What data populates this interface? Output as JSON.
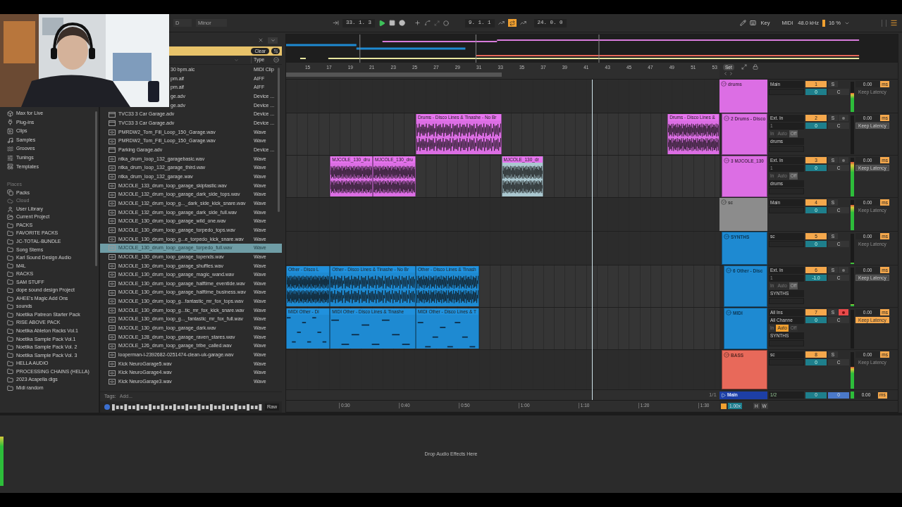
{
  "top_bar": {
    "key_root": "D",
    "scale": "Minor",
    "position": "33. 1. 3",
    "playing": true,
    "loop_start": "9. 1. 1",
    "loop_on": true,
    "loop_length": "24. 0. 0",
    "key_label": "Key",
    "midi_label": "MIDI",
    "sample_rate": "48.0 kHz",
    "cpu": "16 %"
  },
  "browser": {
    "categories": [
      {
        "label": "Max for Live",
        "kind": "max"
      },
      {
        "label": "Plug-ins",
        "kind": "plugins"
      },
      {
        "label": "Clips",
        "kind": "clips"
      },
      {
        "label": "Samples",
        "kind": "samples"
      },
      {
        "label": "Grooves",
        "kind": "grooves"
      },
      {
        "label": "Tunings",
        "kind": "tunings"
      },
      {
        "label": "Templates",
        "kind": "templates"
      }
    ],
    "places_heading": "Places",
    "places": [
      {
        "label": "Packs",
        "kind": "packs",
        "disabled": false
      },
      {
        "label": "Cloud",
        "kind": "cloud",
        "disabled": true
      },
      {
        "label": "User Library",
        "kind": "user",
        "disabled": false
      },
      {
        "label": "Current Project",
        "kind": "project",
        "disabled": false
      },
      {
        "label": "PACKS",
        "kind": "folder",
        "disabled": false
      },
      {
        "label": "FAVORITE PACKS",
        "kind": "folder",
        "disabled": false
      },
      {
        "label": "JC-TOTAL-BUNDLE",
        "kind": "folder",
        "disabled": false
      },
      {
        "label": "Song Stems",
        "kind": "folder",
        "disabled": false
      },
      {
        "label": "Karl Sound Design Audio",
        "kind": "folder",
        "disabled": false
      },
      {
        "label": "M4L",
        "kind": "folder",
        "disabled": false
      },
      {
        "label": "RACKS",
        "kind": "folder",
        "disabled": false
      },
      {
        "label": "SAM STUFF",
        "kind": "folder",
        "disabled": false
      },
      {
        "label": "dope sound design Project",
        "kind": "folder",
        "disabled": false
      },
      {
        "label": "AHEE's Magic Add Ons",
        "kind": "folder",
        "disabled": false
      },
      {
        "label": "sounds",
        "kind": "folder",
        "disabled": false
      },
      {
        "label": "Noetika Patreon Starter Pack",
        "kind": "folder",
        "disabled": false
      },
      {
        "label": "RISE ABOVE PACK",
        "kind": "folder",
        "disabled": false
      },
      {
        "label": "Noetika Ableton Racks Vol.1",
        "kind": "folder",
        "disabled": false
      },
      {
        "label": "Noetika Sample Pack Vol.1",
        "kind": "folder",
        "disabled": false
      },
      {
        "label": "Noetika Sample Pack Vol. 2",
        "kind": "folder",
        "disabled": false
      },
      {
        "label": "Noetika Sample Pack Vol. 3",
        "kind": "folder",
        "disabled": false
      },
      {
        "label": "HELLA AUDIO",
        "kind": "folder",
        "disabled": false
      },
      {
        "label": "PROCESSING CHAINS (HELLA)",
        "kind": "folder",
        "disabled": false
      },
      {
        "label": "2023 Acapella digs",
        "kind": "folder",
        "disabled": false
      },
      {
        "label": "Midi random",
        "kind": "folder",
        "disabled": false
      }
    ],
    "clear_label": "Clear",
    "type_heading": "Type",
    "files": [
      {
        "name": "30 bpm.alc",
        "type": "MIDI Clip",
        "kind": "cut",
        "selected": false
      },
      {
        "name": "pm.aif",
        "type": "AIFF",
        "kind": "cut",
        "selected": false
      },
      {
        "name": "pm.aif",
        "type": "AIFF",
        "kind": "cut",
        "selected": false
      },
      {
        "name": "ge.adv",
        "type": "Device ...",
        "kind": "cut",
        "selected": false
      },
      {
        "name": "ge.adv",
        "type": "Device ...",
        "kind": "cut",
        "selected": false
      },
      {
        "name": "TVC33 3 Car Garage.adv",
        "type": "Device ...",
        "kind": "preset",
        "selected": false
      },
      {
        "name": "TVC33 3 Car Garage.adv",
        "type": "Device ...",
        "kind": "preset",
        "selected": false
      },
      {
        "name": "PMRDW2_Tom_Fill_Loop_150_Garage.wav",
        "type": "Wave",
        "kind": "audio",
        "selected": false
      },
      {
        "name": "PMRDW2_Tom_Fill_Loop_150_Garage.wav",
        "type": "Wave",
        "kind": "audio",
        "selected": false
      },
      {
        "name": "Parking Garage.adv",
        "type": "Device ...",
        "kind": "preset",
        "selected": false
      },
      {
        "name": "ntka_drum_loop_132_garagebasic.wav",
        "type": "Wave",
        "kind": "audio",
        "selected": false
      },
      {
        "name": "ntka_drum_loop_132_garage_third.wav",
        "type": "Wave",
        "kind": "audio",
        "selected": false
      },
      {
        "name": "ntka_drum_loop_132_garage.wav",
        "type": "Wave",
        "kind": "audio",
        "selected": false
      },
      {
        "name": "MJCOLE_133_drum_loop_garage_skiptastic.wav",
        "type": "Wave",
        "kind": "audio",
        "selected": false
      },
      {
        "name": "MJCOLE_132_drum_loop_garage_dark_side_tops.wav",
        "type": "Wave",
        "kind": "audio",
        "selected": false
      },
      {
        "name": "MJCOLE_132_drum_loop_g..._dark_side_kick_snare.wav",
        "type": "Wave",
        "kind": "audio",
        "selected": false
      },
      {
        "name": "MJCOLE_132_drum_loop_garage_dark_side_full.wav",
        "type": "Wave",
        "kind": "audio",
        "selected": false
      },
      {
        "name": "MJCOLE_130_drum_loop_garage_wild_one.wav",
        "type": "Wave",
        "kind": "audio",
        "selected": false
      },
      {
        "name": "MJCOLE_130_drum_loop_garage_torpedo_tops.wav",
        "type": "Wave",
        "kind": "audio",
        "selected": false
      },
      {
        "name": "MJCOLE_130_drum_loop_g...e_torpedo_kick_snare.wav",
        "type": "Wave",
        "kind": "audio",
        "selected": false
      },
      {
        "name": "MJCOLE_130_drum_loop_garage_torpedo_full.wav",
        "type": "Wave",
        "kind": "audio",
        "selected": true
      },
      {
        "name": "MJCOLE_130_drum_loop_garage_topends.wav",
        "type": "Wave",
        "kind": "audio",
        "selected": false
      },
      {
        "name": "MJCOLE_130_drum_loop_garage_shuffles.wav",
        "type": "Wave",
        "kind": "audio",
        "selected": false
      },
      {
        "name": "MJCOLE_130_drum_loop_garage_magic_wand.wav",
        "type": "Wave",
        "kind": "audio",
        "selected": false
      },
      {
        "name": "MJCOLE_130_drum_loop_garage_halftime_eventide.wav",
        "type": "Wave",
        "kind": "audio",
        "selected": false
      },
      {
        "name": "MJCOLE_130_drum_loop_garage_halftime_business.wav",
        "type": "Wave",
        "kind": "audio",
        "selected": false
      },
      {
        "name": "MJCOLE_130_drum_loop_g...fantastic_mr_fox_tops.wav",
        "type": "Wave",
        "kind": "audio",
        "selected": false
      },
      {
        "name": "MJCOLE_130_drum_loop_g...tic_mr_fox_kick_snare.wav",
        "type": "Wave",
        "kind": "audio",
        "selected": false
      },
      {
        "name": "MJCOLE_130_drum_loop_g..._fantastic_mr_fox_full.wav",
        "type": "Wave",
        "kind": "audio",
        "selected": false
      },
      {
        "name": "MJCOLE_130_drum_loop_garage_dark.wav",
        "type": "Wave",
        "kind": "audio",
        "selected": false
      },
      {
        "name": "MJCOLE_128_drum_loop_garage_raven_stares.wav",
        "type": "Wave",
        "kind": "audio",
        "selected": false
      },
      {
        "name": "MJCOLE_126_drum_loop_garage_tribe_called.wav",
        "type": "Wave",
        "kind": "audio",
        "selected": false
      },
      {
        "name": "looperman-l-2392682-0251474-clean-uk-garage.wav",
        "type": "Wave",
        "kind": "audio",
        "selected": false
      },
      {
        "name": "Kick NeuroGarage5.wav",
        "type": "Wave",
        "kind": "audio",
        "selected": false
      },
      {
        "name": "Kick NeuroGarage4.wav",
        "type": "Wave",
        "kind": "audio",
        "selected": false
      },
      {
        "name": "Kick NeuroGarage3.wav",
        "type": "Wave",
        "kind": "audio",
        "selected": false
      }
    ],
    "tags_label": "Tags:",
    "tags_placeholder": "Add...",
    "preview_button": "Raw"
  },
  "arrangement": {
    "ruler_bars": [
      "15",
      "17",
      "19",
      "21",
      "23",
      "25",
      "27",
      "29",
      "31",
      "33",
      "35",
      "37",
      "39",
      "41",
      "43",
      "45",
      "47",
      "49",
      "51",
      "53"
    ],
    "set_button": "Set",
    "tracks": [
      {
        "name": "drums",
        "kind": "group",
        "color": "#dc6ee4",
        "output": "Main",
        "number": "1",
        "volume": "0",
        "solo": "S",
        "pan": "C",
        "level": 0.62,
        "delay": "0.00",
        "unit": "ms",
        "latency": "Keep Latency",
        "children": [
          {
            "name": "2 Drums - Disco",
            "kind": "audio",
            "color": "#dc6ee4",
            "input": "Ext. In",
            "channel": "1",
            "monitor": [
              {
                "label": "In",
                "selected": false
              },
              {
                "label": "Auto",
                "selected": false
              },
              {
                "label": "Off",
                "selected": true
              }
            ],
            "route": "drums",
            "number": "2",
            "volume": "0",
            "solo": "S",
            "pan": "C",
            "arm": false,
            "level": 0,
            "delay": "0.00",
            "unit": "ms",
            "latency": "Keep Latency",
            "keep_latency": false,
            "clips": [
              {
                "name": "Drums - Disco Lines & Tinashe - No Br",
                "selected": false
              },
              {
                "name": "Drums - Disco Lines &",
                "selected": false
              }
            ]
          },
          {
            "name": "3 MJCOLE_130",
            "kind": "audio",
            "color": "#dc6ee4",
            "input": "Ext. In",
            "channel": "1",
            "monitor": [
              {
                "label": "In",
                "selected": false
              },
              {
                "label": "Auto",
                "selected": false
              },
              {
                "label": "Off",
                "selected": true
              }
            ],
            "route": "drums",
            "number": "3",
            "volume": "0",
            "solo": "S",
            "pan": "C",
            "arm": false,
            "level": 0.9,
            "delay": "0.00",
            "unit": "ms",
            "latency": "Keep Latency",
            "keep_latency": false,
            "clips": [
              {
                "name": "MJCOLE_130_dru",
                "selected": false
              },
              {
                "name": "MJCOLE_130_dru",
                "selected": false
              },
              {
                "name": "MJCOLE_130_dr",
                "selected": true
              }
            ]
          }
        ]
      },
      {
        "name": "sc",
        "kind": "group",
        "color": "#8c8c8c",
        "output": "Main",
        "number": "4",
        "volume": "0",
        "solo": "S",
        "pan": "C",
        "level": 0.85,
        "delay": "0.00",
        "unit": "ms",
        "latency": "Keep Latency",
        "children": [
          {
            "name": "SYNTHS",
            "kind": "group",
            "color": "#1e8ad2",
            "output": "sc",
            "number": "5",
            "volume": "0",
            "solo": "S",
            "pan": "C",
            "level": 0.04,
            "delay": "0.00",
            "unit": "ms",
            "latency": "Keep Latency",
            "children": [
              {
                "name": "6 Other - Disc",
                "kind": "audio",
                "color": "#1e8ad2",
                "input": "Ext. In",
                "channel": "1",
                "monitor": [
                  {
                    "label": "In",
                    "selected": false
                  },
                  {
                    "label": "Auto",
                    "selected": false
                  },
                  {
                    "label": "Off",
                    "selected": true
                  }
                ],
                "route": "SYNTHS",
                "number": "6",
                "volume": "-1.0",
                "solo": "S",
                "pan": "C",
                "arm": false,
                "level": 0.04,
                "delay": "0.00",
                "unit": "ms",
                "latency": "Keep Latency",
                "keep_latency": false,
                "clips": [
                  {
                    "name": "Other - Disco L",
                    "selected": false
                  },
                  {
                    "name": "Other - Disco Lines & Tinashe - No Br",
                    "selected": false
                  },
                  {
                    "name": "Other - Disco Lines & Tinash",
                    "selected": false
                  }
                ]
              },
              {
                "name": "MIDI",
                "kind": "midi",
                "color": "#1e8ad2",
                "input": "All Ins",
                "channel": "All Channe",
                "monitor": [
                  {
                    "label": "In",
                    "selected": false
                  },
                  {
                    "label": "Auto",
                    "selected": true
                  },
                  {
                    "label": "Off",
                    "selected": false
                  }
                ],
                "route": "SYNTHS",
                "number": "7",
                "volume": "0",
                "solo": "S",
                "pan": "C",
                "arm": true,
                "level": 0,
                "delay": "0.00",
                "unit": "ms",
                "latency": "Keep Latency",
                "keep_latency": true,
                "clips": [
                  {
                    "name": "MIDI Other - Di",
                    "selected": false
                  },
                  {
                    "name": "MIDI Other - Disco Lines & Tinashe",
                    "selected": false
                  },
                  {
                    "name": "MIDI Other - Disco Lines & T",
                    "selected": false
                  }
                ]
              }
            ]
          },
          {
            "name": "BASS",
            "kind": "group",
            "color": "#e8695a",
            "output": "sc",
            "number": "8",
            "volume": "0",
            "solo": "S",
            "pan": "C",
            "level": 0.6,
            "delay": "0.00",
            "unit": "ms",
            "latency": "Keep Latency"
          }
        ]
      }
    ],
    "main_track": {
      "name": "Main",
      "output": "1/2",
      "volume": "0",
      "pan": "0",
      "delay": "0.00",
      "unit": "ms"
    },
    "zoom_label": "1/1",
    "time_ruler": [
      "0:30",
      "0:40",
      "0:50",
      "1:00",
      "1:10",
      "1:20",
      "1:30"
    ],
    "tempo_scale": "1.00x",
    "h_button": "H",
    "w_button": "W"
  },
  "device_area": {
    "hint": "Drop Audio Effects Here"
  }
}
